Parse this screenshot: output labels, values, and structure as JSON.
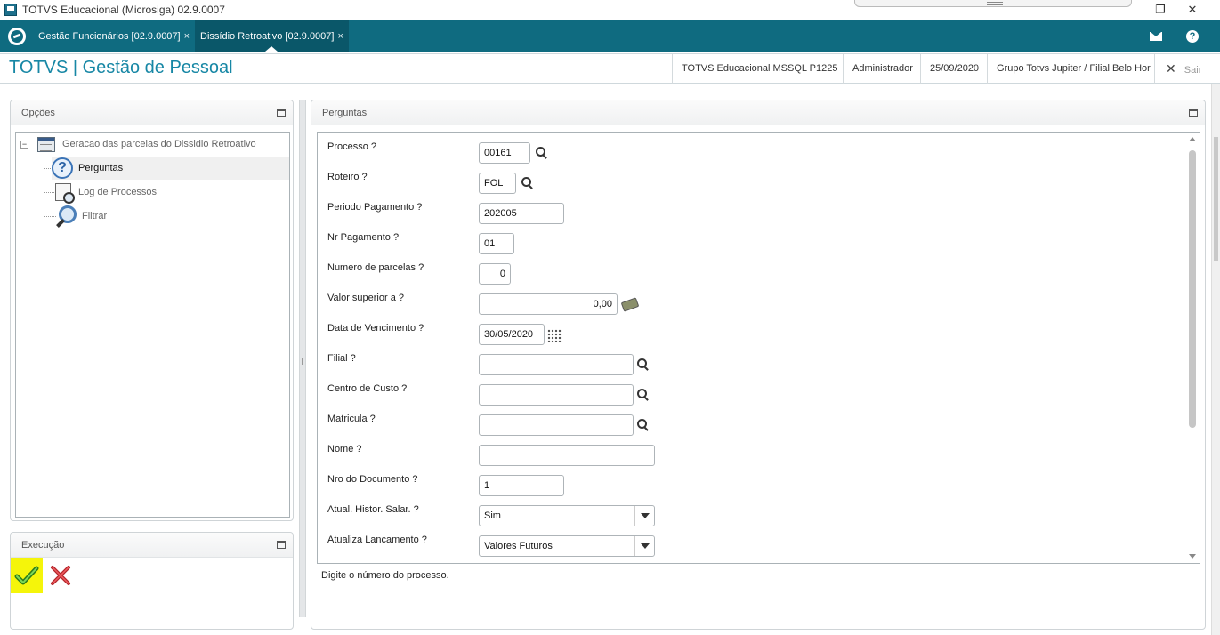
{
  "window": {
    "title": "TOTVS Educacional (Microsiga) 02.9.0007",
    "minimize_glyph": "—",
    "restore_glyph": "❐",
    "close_glyph": "✕"
  },
  "tabs": [
    {
      "label": "Gestão Funcionários [02.9.0007]",
      "close": "×"
    },
    {
      "label": "Dissídio Retroativo [02.9.0007]",
      "close": "×"
    }
  ],
  "header": {
    "brand": "TOTVS | Gestão de Pessoal",
    "environment": "TOTVS Educacional MSSQL P1225",
    "user": "Administrador",
    "date": "25/09/2020",
    "company": "Grupo Totvs Jupiter / Filial Belo Hor",
    "logout_label": "Sair",
    "logout_glyph": "✕"
  },
  "options_panel": {
    "title": "Opções",
    "root": "Geracao das parcelas do Dissidio Retroativo",
    "expander": "−",
    "items": [
      {
        "label": "Perguntas",
        "icon": "question-icon"
      },
      {
        "label": "Log de Processos",
        "icon": "log-icon"
      },
      {
        "label": "Filtrar",
        "icon": "magnifier-icon"
      }
    ]
  },
  "execution_panel": {
    "title": "Execução"
  },
  "questions_panel": {
    "title": "Perguntas",
    "fields": [
      {
        "label": "Processo ?",
        "value": "00161"
      },
      {
        "label": "Roteiro ?",
        "value": "FOL"
      },
      {
        "label": "Periodo Pagamento ?",
        "value": "202005"
      },
      {
        "label": "Nr Pagamento ?",
        "value": "01"
      },
      {
        "label": "Numero de parcelas ?",
        "value": "0"
      },
      {
        "label": "Valor superior a ?",
        "value": "0,00"
      },
      {
        "label": "Data de Vencimento ?",
        "value": "30/05/2020"
      },
      {
        "label": "Filial ?",
        "value": ""
      },
      {
        "label": "Centro de Custo ?",
        "value": ""
      },
      {
        "label": "Matricula ?",
        "value": ""
      },
      {
        "label": "Nome ?",
        "value": ""
      },
      {
        "label": "Nro do Documento ?",
        "value": "1"
      },
      {
        "label": "Atual. Histor. Salar. ?",
        "value": "Sim"
      },
      {
        "label": "Atualiza Lancamento ?",
        "value": "Valores Futuros"
      }
    ],
    "hint": "Digite o número do processo."
  },
  "colors": {
    "tabbar": "#0f6b80",
    "brand": "#1787a5",
    "confirm_highlight": "#f5f50a"
  }
}
